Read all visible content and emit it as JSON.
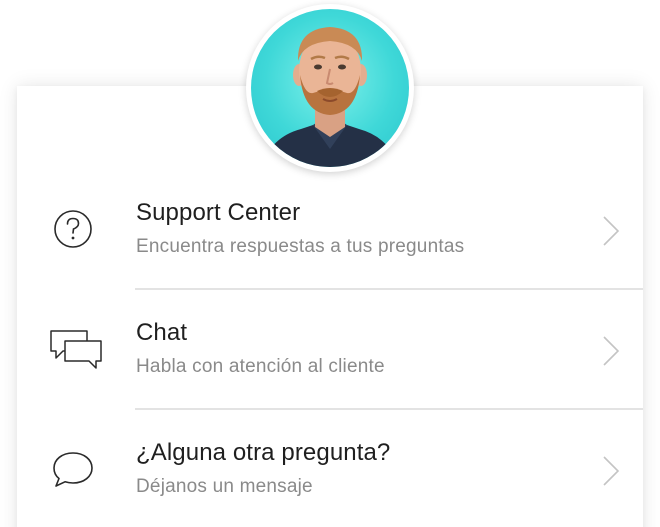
{
  "colors": {
    "title": "#1f1f1f",
    "subtitle": "#8a8a8a",
    "divider": "#e3e3e3",
    "chevron": "#c4c4c4",
    "avatar_background": "#3fd8d8"
  },
  "avatar": {
    "icon": "agent-photo"
  },
  "menu": {
    "items": [
      {
        "icon": "question-circle-icon",
        "title": "Support Center",
        "subtitle": "Encuentra respuestas a tus preguntas"
      },
      {
        "icon": "chat-bubbles-icon",
        "title": "Chat",
        "subtitle": "Habla con atención al cliente"
      },
      {
        "icon": "speech-bubble-icon",
        "title": "¿Alguna otra pregunta?",
        "subtitle": "Déjanos un mensaje"
      }
    ]
  }
}
